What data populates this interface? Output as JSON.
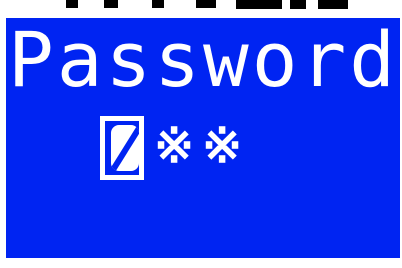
{
  "screen": {
    "title": "Password",
    "masked_chars": [
      "※",
      "※"
    ],
    "cursor_icon": "edit-digit-cursor-icon",
    "background_color": "#0024f2",
    "text_color": "#ffffff"
  }
}
